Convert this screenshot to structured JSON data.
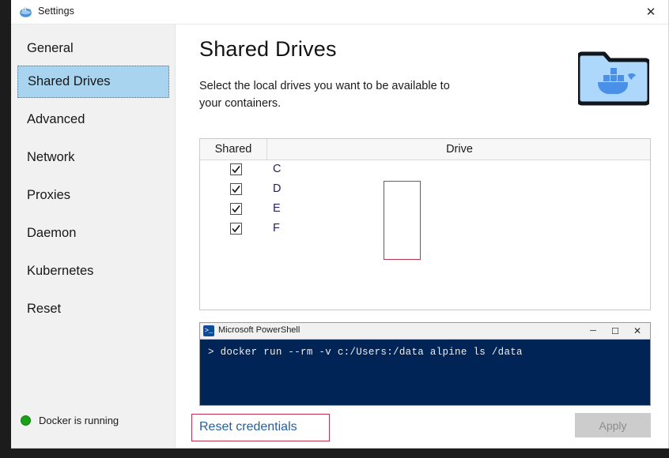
{
  "window": {
    "title": "Settings",
    "icon": "docker-whale-icon",
    "close_label": "✕"
  },
  "sidebar": {
    "items": [
      {
        "label": "General",
        "selected": false
      },
      {
        "label": "Shared Drives",
        "selected": true
      },
      {
        "label": "Advanced",
        "selected": false
      },
      {
        "label": "Network",
        "selected": false
      },
      {
        "label": "Proxies",
        "selected": false
      },
      {
        "label": "Daemon",
        "selected": false
      },
      {
        "label": "Kubernetes",
        "selected": false
      },
      {
        "label": "Reset",
        "selected": false
      }
    ],
    "status": {
      "text": "Docker is running",
      "dot_color": "#18a018"
    }
  },
  "main": {
    "title": "Shared Drives",
    "subtitle": "Select the local drives you want to be available to your containers.",
    "hero_icon": "folder-with-whale-icon",
    "table": {
      "columns": [
        "Shared",
        "Drive"
      ],
      "rows": [
        {
          "shared": true,
          "drive": "C"
        },
        {
          "shared": true,
          "drive": "D"
        },
        {
          "shared": true,
          "drive": "E"
        },
        {
          "shared": true,
          "drive": "F"
        }
      ]
    },
    "powershell": {
      "title": "Microsoft PowerShell",
      "icon": ">_",
      "minimize_label": "─",
      "maximize_label": "☐",
      "close_label": "✕",
      "command": "> docker run --rm -v c:/Users:/data alpine ls /data"
    },
    "footer": {
      "reset_credentials_label": "Reset credentials",
      "apply_label": "Apply"
    }
  },
  "annotations": {
    "color": "#c0334d",
    "regions": [
      "shared-checkbox-column",
      "reset-credentials-link"
    ]
  }
}
